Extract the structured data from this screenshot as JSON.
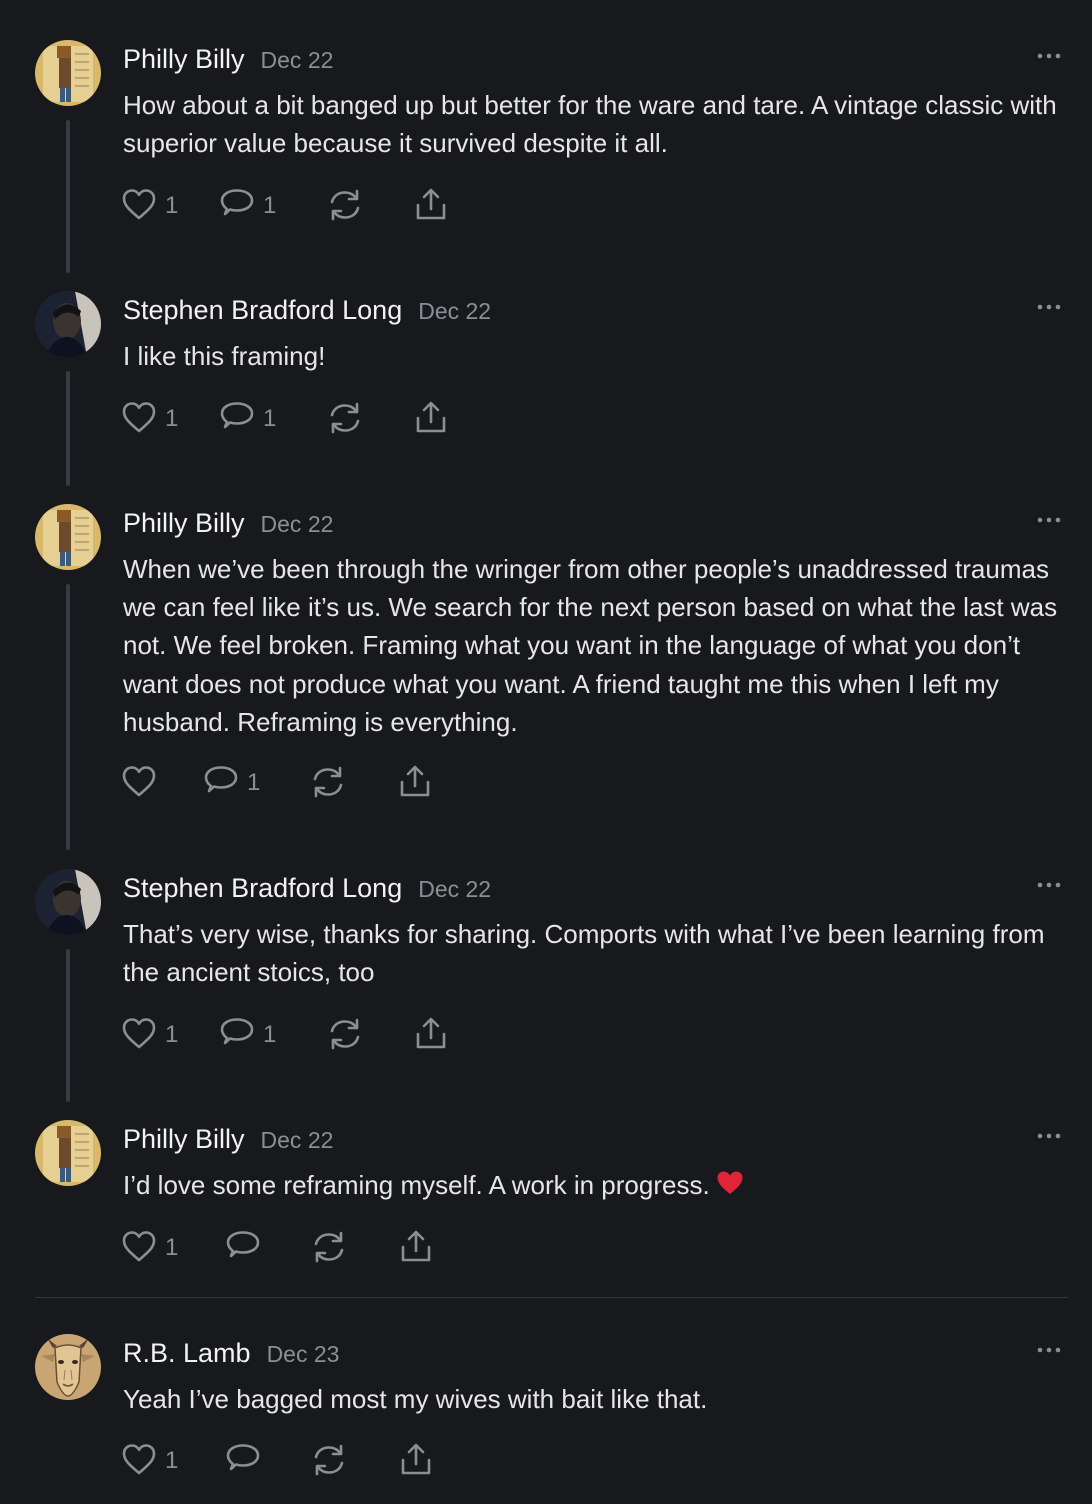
{
  "comments": [
    {
      "author": "Philly Billy",
      "date": "Dec 22",
      "text": "How about a bit banged up but better for the ware and tare. A vintage classic with superior value because it survived despite it all.",
      "likes": "1",
      "replies": "1",
      "avatar": "philly-billy"
    },
    {
      "author": "Stephen Bradford Long",
      "date": "Dec 22",
      "text": "I like this framing!",
      "likes": "1",
      "replies": "1",
      "avatar": "stephen"
    },
    {
      "author": "Philly Billy",
      "date": "Dec 22",
      "text": "When we’ve been through the wringer from other people’s unaddressed traumas we can feel like it’s us. We search for the next person based on what the last was not. We feel broken. Framing what you want in the language of what you don’t want does not produce what you want. A friend taught me this when I left my husband. Reframing is everything.",
      "likes": "",
      "replies": "1",
      "avatar": "philly-billy"
    },
    {
      "author": "Stephen Bradford Long",
      "date": "Dec 22",
      "text": "That’s very wise, thanks for sharing. Comports with what I’ve been learning from the ancient stoics, too",
      "likes": "1",
      "replies": "1",
      "avatar": "stephen"
    },
    {
      "author": "Philly Billy",
      "date": "Dec 22",
      "text": "I’d love some reframing myself. A work in progress.",
      "likes": "1",
      "replies": "",
      "avatar": "philly-billy",
      "emoji": "red-heart-emoji"
    },
    {
      "author": "R.B. Lamb",
      "date": "Dec 23",
      "text": "Yeah I’ve bagged most my wives with bait like that.",
      "likes": "1",
      "replies": "",
      "avatar": "goat"
    }
  ],
  "icons": {
    "like": "heart-outline-icon",
    "reply": "speech-bubble-icon",
    "restack": "restack-arrows-icon",
    "share": "share-upload-icon",
    "more": "more-dots-icon"
  },
  "colors": {
    "background": "#18191d",
    "text": "#e6e6e6",
    "muted": "#8d8e93",
    "heart": "#e0243a"
  }
}
